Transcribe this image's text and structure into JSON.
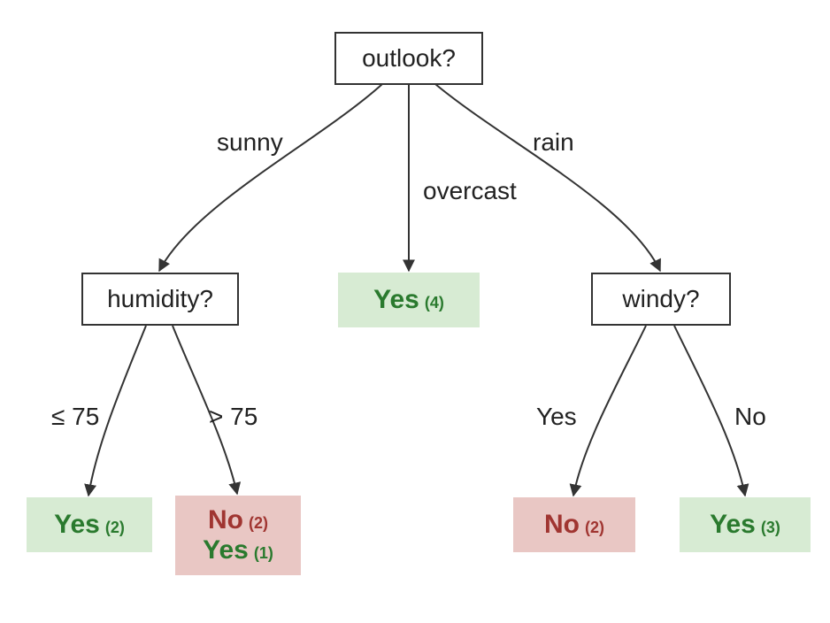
{
  "nodes": {
    "root": {
      "label": "outlook?"
    },
    "humidity": {
      "label": "humidity?"
    },
    "windy": {
      "label": "windy?"
    },
    "leaf_overcast": {
      "lines": [
        {
          "label": "Yes",
          "count": "(4)",
          "cls": "yes"
        }
      ],
      "bg": "yes"
    },
    "leaf_hum_le75": {
      "lines": [
        {
          "label": "Yes",
          "count": "(2)",
          "cls": "yes"
        }
      ],
      "bg": "yes"
    },
    "leaf_hum_gt75": {
      "lines": [
        {
          "label": "No",
          "count": "(2)",
          "cls": "no"
        },
        {
          "label": "Yes",
          "count": "(1)",
          "cls": "yes"
        }
      ],
      "bg": "no"
    },
    "leaf_windy_yes": {
      "lines": [
        {
          "label": "No",
          "count": "(2)",
          "cls": "no"
        }
      ],
      "bg": "no"
    },
    "leaf_windy_no": {
      "lines": [
        {
          "label": "Yes",
          "count": "(3)",
          "cls": "yes"
        }
      ],
      "bg": "yes"
    }
  },
  "edges": {
    "sunny": "sunny",
    "overcast": "overcast",
    "rain": "rain",
    "le75": "≤ 75",
    "gt75": "> 75",
    "windyYes": "Yes",
    "windyNo": "No"
  }
}
